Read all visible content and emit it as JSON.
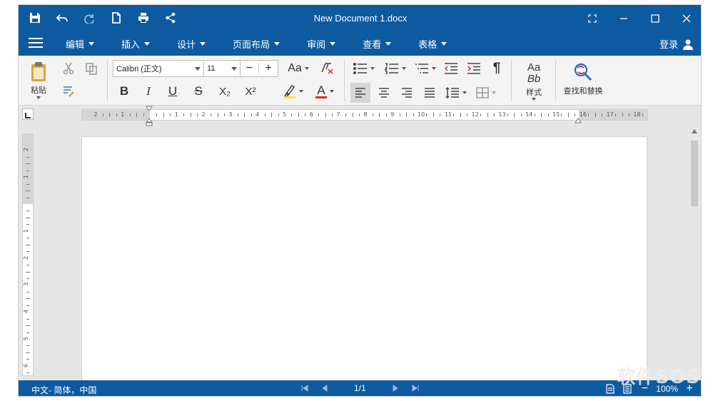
{
  "window": {
    "title": "New Document 1.docx"
  },
  "menu": {
    "items": [
      {
        "label": "编辑"
      },
      {
        "label": "插入"
      },
      {
        "label": "设计"
      },
      {
        "label": "页面布局"
      },
      {
        "label": "审阅"
      },
      {
        "label": "查看"
      },
      {
        "label": "表格"
      }
    ],
    "login_label": "登录"
  },
  "ribbon": {
    "paste_label": "粘贴",
    "font_name": "Calibri (正文)",
    "font_size": "11",
    "size_decrease": "−",
    "size_increase": "+",
    "case_label": "Aa",
    "bold": "B",
    "italic": "I",
    "underline": "U",
    "strike": "S",
    "subscript": "X₂",
    "superscript": "X²",
    "highlight_letter": "",
    "font_color_letter": "A",
    "pilcrow": "¶",
    "styles_preview_top": "Aa",
    "styles_preview_bottom": "Bb",
    "styles_label": "样式",
    "find_replace_label": "查找和替换",
    "highlight_color": "#f5e84a",
    "font_color": "#d32f2f"
  },
  "ruler": {
    "h_labels": [
      "2",
      "1",
      "",
      "1",
      "2",
      "3",
      "4",
      "5",
      "6",
      "7",
      "8",
      "9",
      "10",
      "11",
      "12",
      "13",
      "14",
      "15",
      "16",
      "17",
      "18"
    ],
    "v_labels": [
      "2",
      "1",
      "",
      "1",
      "2",
      "3",
      "4",
      "5",
      "6"
    ]
  },
  "status": {
    "language": "中文- 简体，中国",
    "page": "1/1",
    "zoom": "100%"
  },
  "watermark": "软件SOS",
  "colors": {
    "accent": "#0e5aa0",
    "workspace": "#e6e6e6",
    "ribbon": "#f3f3f3"
  }
}
